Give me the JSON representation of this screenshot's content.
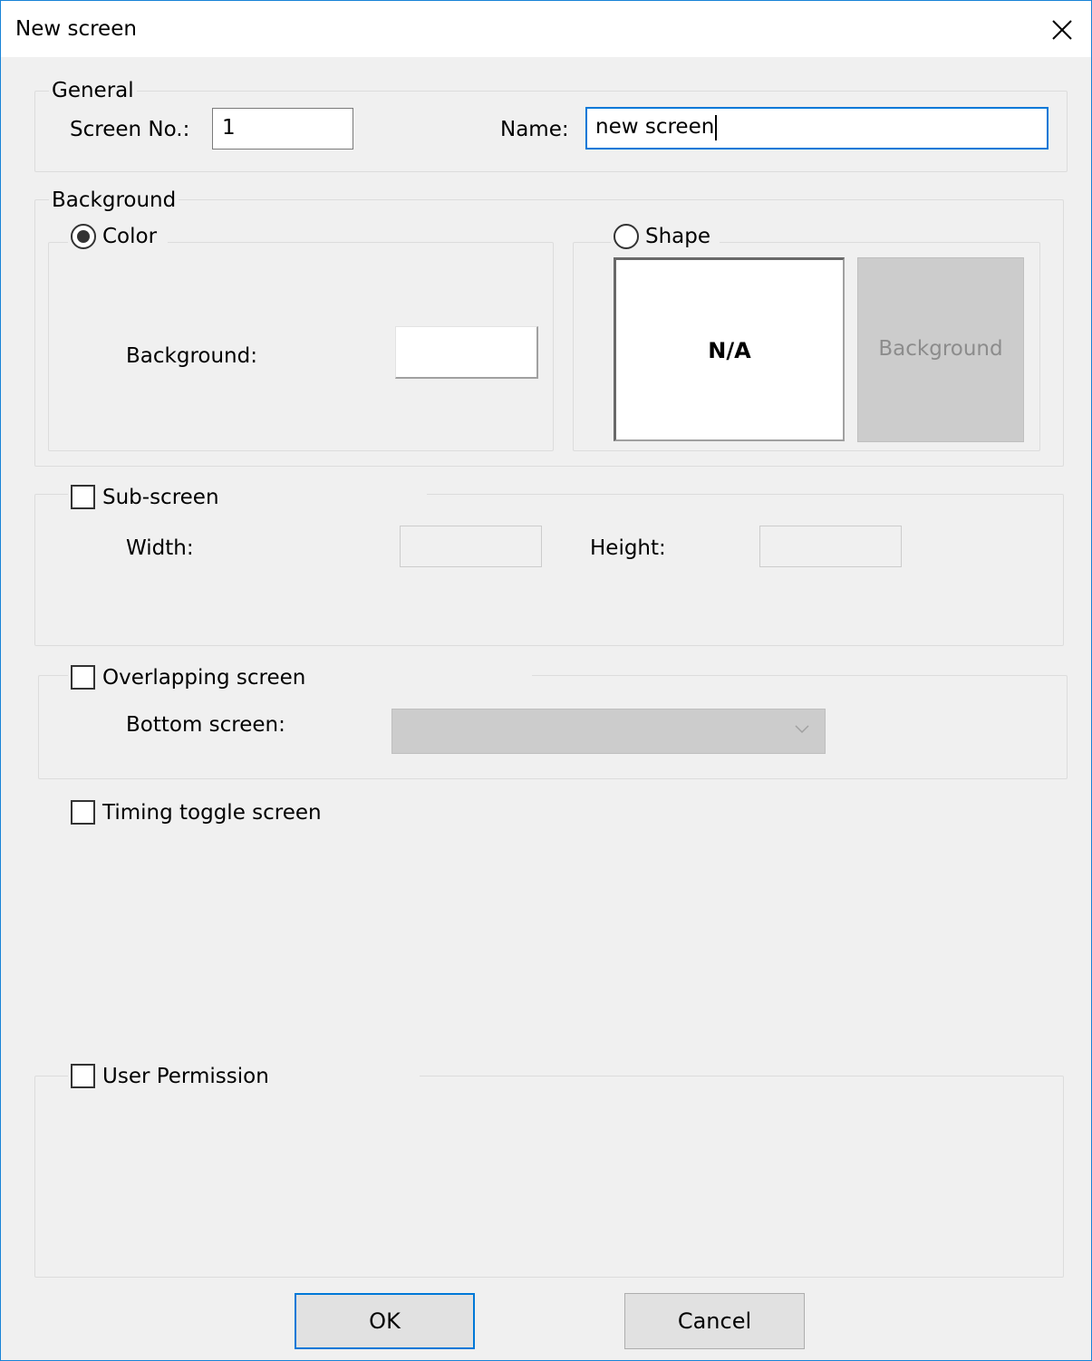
{
  "window": {
    "title": "New screen"
  },
  "general": {
    "legend": "General",
    "screen_no_label": "Screen No.:",
    "screen_no_value": "1",
    "name_label": "Name:",
    "name_value": "new screen"
  },
  "background": {
    "legend": "Background",
    "color_option_label": "Color",
    "color_selected": true,
    "background_label": "Background:",
    "background_color": "#ffffff",
    "shape_option_label": "Shape",
    "shape_selected": false,
    "shape_preview_text": "N/A",
    "shape_background_button": "Background"
  },
  "subscreen": {
    "label": "Sub-screen",
    "checked": false,
    "width_label": "Width:",
    "width_value": "",
    "height_label": "Height:",
    "height_value": ""
  },
  "overlapping": {
    "label": "Overlapping screen",
    "checked": false,
    "bottom_screen_label": "Bottom screen:",
    "bottom_screen_value": ""
  },
  "timing_toggle": {
    "label": "Timing toggle screen",
    "checked": false
  },
  "user_permission": {
    "label": "User Permission",
    "checked": false
  },
  "buttons": {
    "ok": "OK",
    "cancel": "Cancel"
  },
  "colors": {
    "accent": "#0078d7",
    "window_border": "#1883d7",
    "dialog_bg": "#f0f0f0"
  },
  "icons": {
    "close": "close-icon",
    "dropdown": "chevron-down-icon"
  }
}
